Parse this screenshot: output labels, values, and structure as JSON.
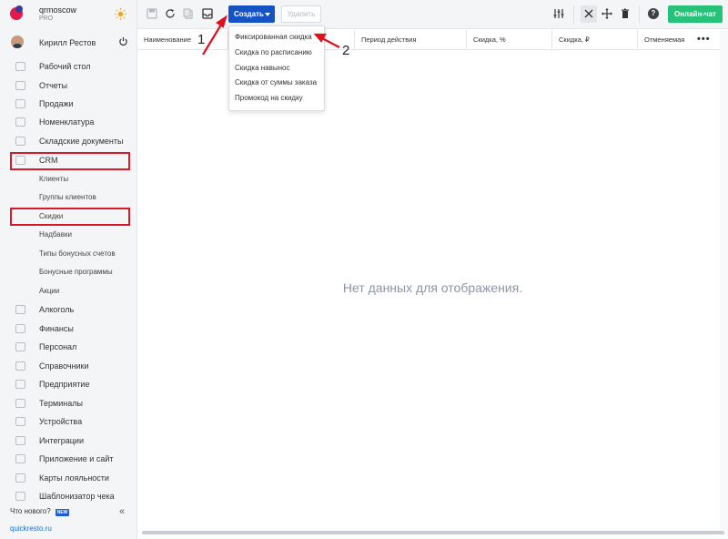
{
  "brand": {
    "name": "qrmoscow",
    "plan": "PRO"
  },
  "user": {
    "name": "Кирилл Рестов"
  },
  "sidebar": {
    "items": [
      {
        "label": "Рабочий стол"
      },
      {
        "label": "Отчеты"
      },
      {
        "label": "Продажи"
      },
      {
        "label": "Номенклатура"
      },
      {
        "label": "Складские документы"
      },
      {
        "label": "CRM"
      },
      {
        "label": "Клиенты"
      },
      {
        "label": "Группы клиентов"
      },
      {
        "label": "Скидки"
      },
      {
        "label": "Надбавки"
      },
      {
        "label": "Типы бонусных счетов"
      },
      {
        "label": "Бонусные программы"
      },
      {
        "label": "Акции"
      },
      {
        "label": "Алкоголь"
      },
      {
        "label": "Финансы"
      },
      {
        "label": "Персонал"
      },
      {
        "label": "Справочники"
      },
      {
        "label": "Предприятие"
      },
      {
        "label": "Терминалы"
      },
      {
        "label": "Устройства"
      },
      {
        "label": "Интеграции"
      },
      {
        "label": "Приложение и сайт"
      },
      {
        "label": "Карты лояльности"
      },
      {
        "label": "Шаблонизатор чека"
      }
    ],
    "whats_new": "Что нового?",
    "new_badge": "NEW",
    "collapse": "«",
    "site_link": "quickresto.ru"
  },
  "toolbar": {
    "create_label": "Создать",
    "delete_label": "Удалить",
    "chat_label": "Онлайн-чат",
    "help_label": "?"
  },
  "grid": {
    "columns": [
      "Наименование",
      "",
      "Период действия",
      "Скидка, %",
      "Скидка, ₽",
      "Отменяемая"
    ],
    "more": "•••",
    "empty_text": "Нет данных для отображения."
  },
  "dropdown": {
    "items": [
      "Фиксированная скидка",
      "Скидка по расписанию",
      "Скидка навынос",
      "Скидка от суммы заказа",
      "Промокод на скидку"
    ]
  },
  "annotations": {
    "step1": "1",
    "step2": "2",
    "color": "#e0101e"
  },
  "colors": {
    "primary": "#1553c4",
    "chat": "#27c27a",
    "highlight": "#d7192a"
  }
}
